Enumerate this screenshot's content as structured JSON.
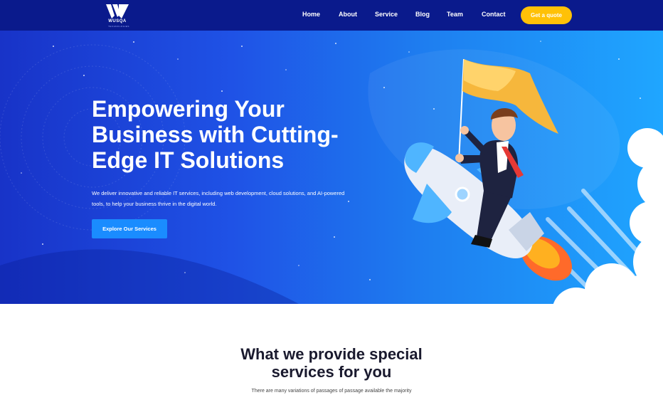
{
  "brand": {
    "name": "WUSQA",
    "tagline": "TECHNOLOGIES",
    "logo_icon": "w-logo-icon",
    "colors": {
      "nav_bg": "#0a1a8c",
      "accent": "#ffc107",
      "hero_start": "#1833c8",
      "hero_end": "#1fa6ff"
    }
  },
  "nav": {
    "items": [
      {
        "label": "Home"
      },
      {
        "label": "About"
      },
      {
        "label": "Service"
      },
      {
        "label": "Blog"
      },
      {
        "label": "Team"
      },
      {
        "label": "Contact"
      }
    ],
    "cta_label": "Get a quote"
  },
  "hero": {
    "title": "Empowering Your Business with Cutting-Edge IT Solutions",
    "description": "We deliver innovative and reliable IT services, including web development, cloud solutions, and AI-powered tools, to help your business thrive in the digital world.",
    "button_label": "Explore Our Services",
    "illustration": "rocket-businessman-illustration"
  },
  "services": {
    "title": "What we provide special services for you",
    "description": "There are many variations of passages of passage available the majority"
  }
}
